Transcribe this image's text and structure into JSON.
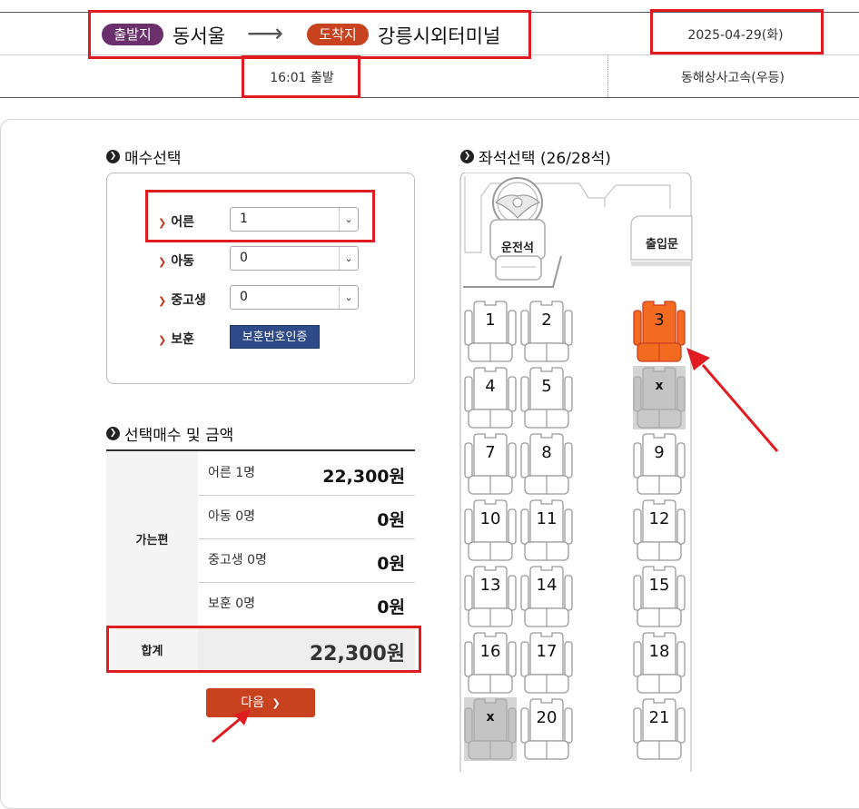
{
  "route": {
    "departure_badge": "출발지",
    "departure": "동서울",
    "arrow": "⟶",
    "arrival_badge": "도착지",
    "arrival": "강릉시외터미널",
    "date": "2025-04-29(화)",
    "time": "16:01 출발",
    "company": "동해상사고속(우등)"
  },
  "ticket_count": {
    "title": "매수선택",
    "rows": [
      {
        "label": "어른",
        "value": "1"
      },
      {
        "label": "아동",
        "value": "0"
      },
      {
        "label": "중고생",
        "value": "0"
      }
    ],
    "veteran_label": "보훈",
    "veteran_button": "보훈번호인증"
  },
  "fare": {
    "title": "선택매수 및 금액",
    "group_label": "가는편",
    "rows": [
      {
        "label": "어른 1명",
        "amount": "22,300원"
      },
      {
        "label": "아동 0명",
        "amount": "0원"
      },
      {
        "label": "중고생 0명",
        "amount": "0원"
      },
      {
        "label": "보훈 0명",
        "amount": "0원"
      }
    ],
    "total_label": "합계",
    "total_amount": "22,300원"
  },
  "next_button": "다음",
  "seat_map": {
    "title": "좌석선택 (26/28석)",
    "driver_label": "운전석",
    "door_label": "출입문",
    "seats": [
      {
        "label": "1",
        "state": "available"
      },
      {
        "label": "2",
        "state": "available"
      },
      {
        "label": "3",
        "state": "selected"
      },
      {
        "label": "4",
        "state": "available"
      },
      {
        "label": "5",
        "state": "available"
      },
      {
        "label": "x",
        "state": "sold"
      },
      {
        "label": "7",
        "state": "available"
      },
      {
        "label": "8",
        "state": "available"
      },
      {
        "label": "9",
        "state": "available"
      },
      {
        "label": "10",
        "state": "available"
      },
      {
        "label": "11",
        "state": "available"
      },
      {
        "label": "12",
        "state": "available"
      },
      {
        "label": "13",
        "state": "available"
      },
      {
        "label": "14",
        "state": "available"
      },
      {
        "label": "15",
        "state": "available"
      },
      {
        "label": "16",
        "state": "available"
      },
      {
        "label": "17",
        "state": "available"
      },
      {
        "label": "18",
        "state": "available"
      },
      {
        "label": "x",
        "state": "sold"
      },
      {
        "label": "20",
        "state": "available"
      },
      {
        "label": "21",
        "state": "available"
      }
    ]
  },
  "colors": {
    "departure_badge": "#6b2f6e",
    "arrival_badge": "#c9421f",
    "selected_seat": "#f26b21",
    "sold_seat": "#c4c4c4",
    "highlight": "#e11b22",
    "auth_button": "#2f4a88"
  }
}
